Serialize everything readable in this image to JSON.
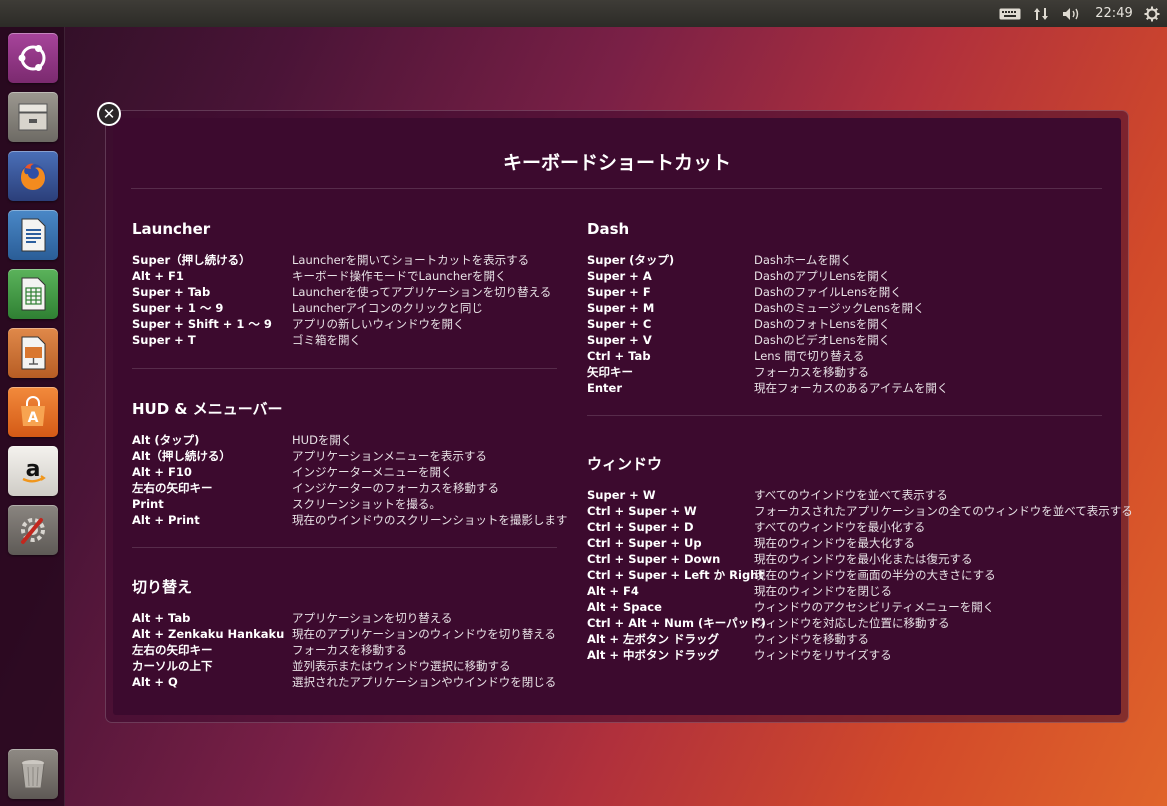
{
  "panel": {
    "keyboard_icon": "keyboard-icon",
    "network_icon": "network-arrows-icon",
    "volume_icon": "volume-icon",
    "clock": "22:49",
    "settings_icon": "gear-icon"
  },
  "launcher": {
    "items": [
      {
        "name": "ubuntu-dash-icon"
      },
      {
        "name": "files-icon"
      },
      {
        "name": "firefox-icon"
      },
      {
        "name": "writer-icon"
      },
      {
        "name": "calc-icon"
      },
      {
        "name": "impress-icon"
      },
      {
        "name": "software-center-icon"
      },
      {
        "name": "amazon-icon"
      },
      {
        "name": "system-settings-icon"
      },
      {
        "name": "trash-icon"
      }
    ]
  },
  "overlay": {
    "close_glyph": "✕",
    "title": "キーボードショートカット",
    "sections": {
      "launcher": {
        "title": "Launcher",
        "rows": [
          {
            "key": "Super（押し続ける）",
            "desc": "Launcherを開いてショートカットを表示する"
          },
          {
            "key": "Alt + F1",
            "desc": "キーボード操作モードでLauncherを開く"
          },
          {
            "key": "Super + Tab",
            "desc": "Launcherを使ってアプリケーションを切り替える"
          },
          {
            "key": "Super + 1 〜 9",
            "desc": "Launcherアイコンのクリックと同じ"
          },
          {
            "key": "Super + Shift + 1 〜 9",
            "desc": "アプリの新しいウィンドウを開く"
          },
          {
            "key": "Super + T",
            "desc": "ゴミ箱を開く"
          }
        ]
      },
      "hud": {
        "title": "HUD & メニューバー",
        "rows": [
          {
            "key": "Alt (タップ)",
            "desc": "HUDを開く"
          },
          {
            "key": "Alt（押し続ける）",
            "desc": "アプリケーションメニューを表示する"
          },
          {
            "key": "Alt + F10",
            "desc": "インジケーターメニューを開く"
          },
          {
            "key": "左右の矢印キー",
            "desc": "インジケーターのフォーカスを移動する"
          },
          {
            "key": "Print",
            "desc": "スクリーンショットを撮る。"
          },
          {
            "key": "Alt + Print",
            "desc": "現在のウインドウのスクリーンショットを撮影します"
          }
        ]
      },
      "switching": {
        "title": "切り替え",
        "rows": [
          {
            "key": "Alt + Tab",
            "desc": "アプリケーションを切り替える"
          },
          {
            "key": "Alt + Zenkaku Hankaku",
            "desc": "現在のアプリケーションのウィンドウを切り替える"
          },
          {
            "key": "左右の矢印キー",
            "desc": "フォーカスを移動する"
          },
          {
            "key": "カーソルの上下",
            "desc": "並列表示またはウィンドウ選択に移動する"
          },
          {
            "key": "Alt + Q",
            "desc": "選択されたアプリケーションやウインドウを閉じる"
          }
        ]
      },
      "dash": {
        "title": "Dash",
        "rows": [
          {
            "key": "Super (タップ)",
            "desc": "Dashホームを開く"
          },
          {
            "key": "Super + A",
            "desc": "DashのアプリLensを開く"
          },
          {
            "key": "Super + F",
            "desc": "DashのファイルLensを開く"
          },
          {
            "key": "Super + M",
            "desc": "DashのミュージックLensを開く"
          },
          {
            "key": "Super + C",
            "desc": "DashのフォトLensを開く"
          },
          {
            "key": "Super + V",
            "desc": "DashのビデオLensを開く"
          },
          {
            "key": "Ctrl + Tab",
            "desc": "Lens 間で切り替える"
          },
          {
            "key": "矢印キー",
            "desc": "フォーカスを移動する"
          },
          {
            "key": "Enter",
            "desc": "現在フォーカスのあるアイテムを開く"
          }
        ]
      },
      "window": {
        "title": "ウィンドウ",
        "rows": [
          {
            "key": "Super + W",
            "desc": "すべてのウインドウを並べて表示する"
          },
          {
            "key": "Ctrl + Super + W",
            "desc": "フォーカスされたアプリケーションの全てのウィンドウを並べて表示する"
          },
          {
            "key": "Ctrl + Super + D",
            "desc": "すべてのウィンドウを最小化する"
          },
          {
            "key": "Ctrl + Super + Up",
            "desc": "現在のウィンドウを最大化する"
          },
          {
            "key": "Ctrl + Super + Down",
            "desc": "現在のウィンドウを最小化または復元する"
          },
          {
            "key": "Ctrl + Super + Left か Right",
            "desc": "現在のウィンドウを画面の半分の大きさにする"
          },
          {
            "key": "Alt + F4",
            "desc": "現在のウィンドウを閉じる"
          },
          {
            "key": "Alt + Space",
            "desc": "ウィンドウのアクセシビリティメニューを開く"
          },
          {
            "key": "Ctrl + Alt + Num (キーパッド)",
            "desc": "ウィンドウを対応した位置に移動する"
          },
          {
            "key": "Alt + 左ボタン ドラッグ",
            "desc": "ウィンドウを移動する"
          },
          {
            "key": "Alt + 中ボタン ドラッグ",
            "desc": "ウィンドウをリサイズする"
          }
        ]
      }
    }
  }
}
